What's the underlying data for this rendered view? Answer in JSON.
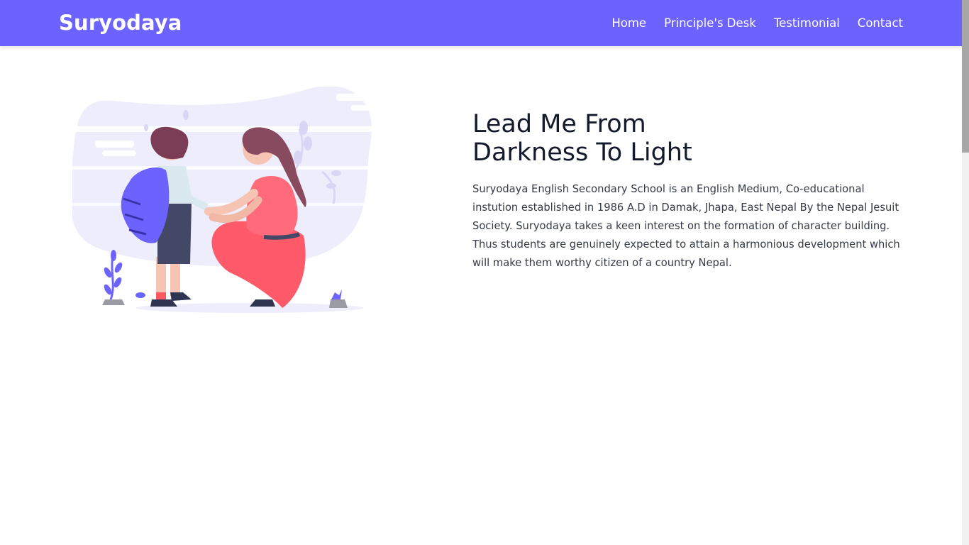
{
  "brand": {
    "name": "Suryodaya"
  },
  "nav": {
    "items": [
      {
        "label": "Home"
      },
      {
        "label": "Principle's Desk"
      },
      {
        "label": "Testimonial"
      },
      {
        "label": "Contact"
      }
    ]
  },
  "hero": {
    "title": "Lead Me From Darkness To Light",
    "description": "Suryodaya English Secondary School is an English Medium, Co-educational instution established in 1986 A.D in Damak, Jhapa, East Nepal By the Nepal Jesuit Society. Suryodaya takes a keen interest on the formation of character building. Thus students are genuinely expected to attain a harmonious development which will make them worthy citizen of a country Nepal.",
    "illustration": "mother-child-illustration"
  },
  "colors": {
    "accent": "#6c63ff",
    "text_dark": "#141a2b",
    "text_body": "#353a46"
  }
}
